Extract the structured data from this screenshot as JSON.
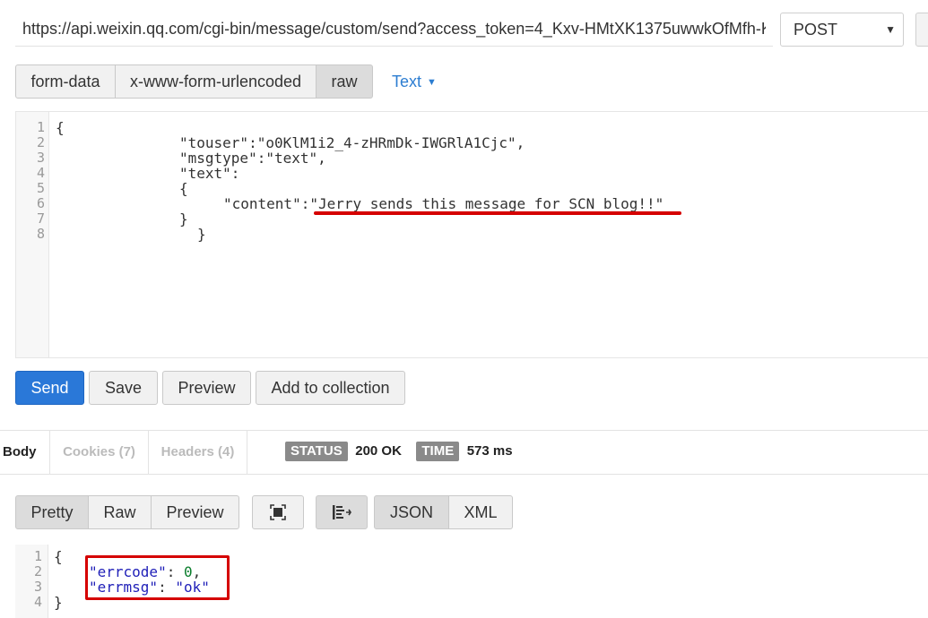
{
  "request": {
    "url": "https://api.weixin.qq.com/cgi-bin/message/custom/send?access_token=4_Kxv-HMtXK1375uwwkOfMfh-K",
    "method": "POST",
    "body_modes": [
      "form-data",
      "x-www-form-urlencoded",
      "raw"
    ],
    "active_body_mode": "raw",
    "content_type": "Text",
    "line_numbers": [
      "1",
      "2",
      "3",
      "4",
      "5",
      "6",
      "7",
      "8"
    ],
    "body_lines": [
      "{",
      "\"touser\":\"o0KlM1i2_4-zHRmDk-IWGRlA1Cjc\",",
      "\"msgtype\":\"text\",",
      "\"text\":",
      "{",
      "\"content\":\"Jerry sends this message for SCN blog!!\"",
      "}",
      "}"
    ]
  },
  "actions": {
    "send": "Send",
    "save": "Save",
    "preview": "Preview",
    "add_to_collection": "Add to collection"
  },
  "response_tabs": {
    "body": "Body",
    "cookies": "Cookies (7)",
    "headers": "Headers (4)"
  },
  "status": {
    "status_label": "STATUS",
    "status_value": "200 OK",
    "time_label": "TIME",
    "time_value": "573 ms"
  },
  "view_modes": {
    "pretty": "Pretty",
    "raw": "Raw",
    "preview": "Preview",
    "json": "JSON",
    "xml": "XML"
  },
  "response": {
    "line_numbers": [
      "1",
      "2",
      "3",
      "4"
    ],
    "open_brace": "{",
    "close_brace": "}",
    "errcode_key": "\"errcode\"",
    "errcode_value": "0",
    "errmsg_key": "\"errmsg\"",
    "errmsg_value": "\"ok\""
  },
  "colors": {
    "accent": "#2a78d8",
    "highlight_red": "#d50000",
    "json_key": "#1f1fb8",
    "json_number": "#0a7d2c"
  },
  "icons": [
    "fullscreen-icon",
    "wrap-lines-icon",
    "chevron-down-icon"
  ]
}
